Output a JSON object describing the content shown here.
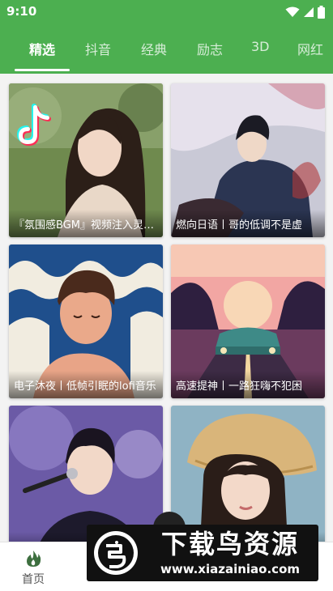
{
  "status_bar": {
    "time": "9:10",
    "icons": [
      "wifi-icon",
      "signal-icon",
      "battery-icon"
    ]
  },
  "tabs": [
    {
      "label": "精选",
      "active": true
    },
    {
      "label": "抖音",
      "active": false
    },
    {
      "label": "经典",
      "active": false
    },
    {
      "label": "励志",
      "active": false
    },
    {
      "label": "3D",
      "active": false
    },
    {
      "label": "网红",
      "active": false
    }
  ],
  "cards": [
    {
      "title": "『氛围感BGM』视频注入灵魂的音乐",
      "image": "tiktok-girl-portrait-photo"
    },
    {
      "title": "燃向日语丨哥的低调不是虚",
      "image": "anime-character-illustration"
    },
    {
      "title": "电子沐夜丨低帧引眠的lofi音乐",
      "image": "lofi-boy-in-waves-illustration"
    },
    {
      "title": "高速提神丨一路狂嗨不犯困",
      "image": "retro-car-on-road-illustration"
    },
    {
      "title": "",
      "image": "male-singer-with-microphone-photo"
    },
    {
      "title": "",
      "image": "girl-with-straw-hat-photo"
    }
  ],
  "bottom_nav": [
    {
      "label": "首页",
      "icon": "flame-icon"
    }
  ],
  "watermark": {
    "title": "下载鸟资源",
    "url": "www.xiazainiao.com"
  },
  "colors": {
    "primary": "#4caf50",
    "background": "#f3f3f3"
  }
}
